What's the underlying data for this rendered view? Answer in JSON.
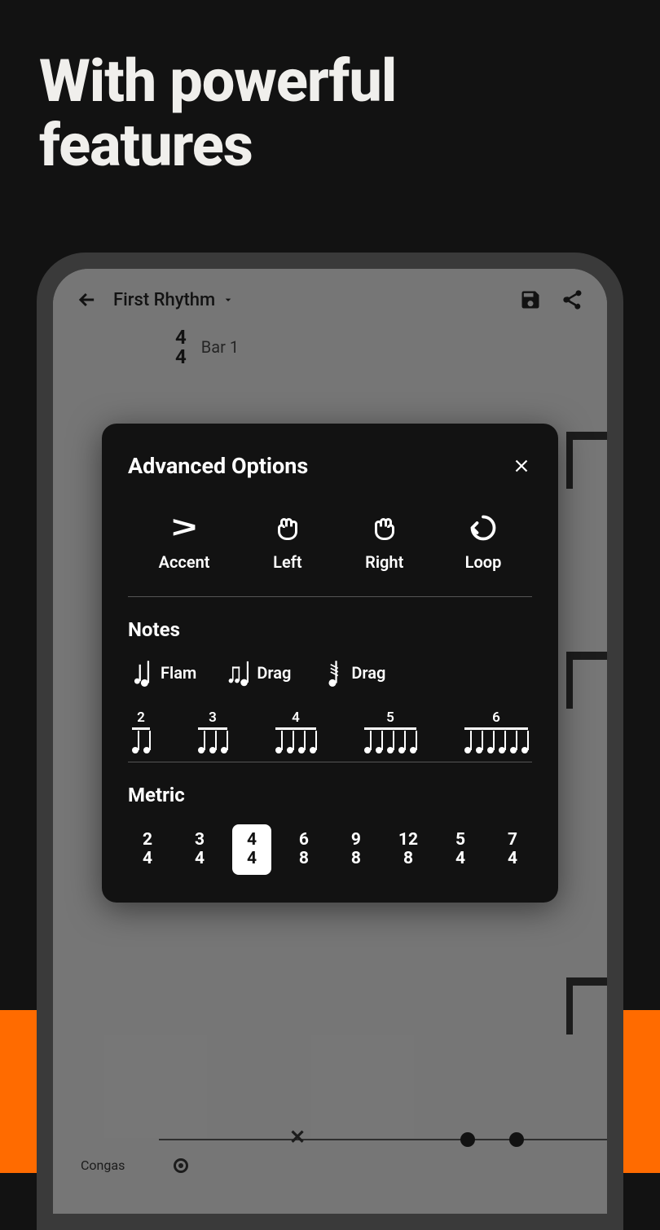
{
  "headline": "With powerful features",
  "app": {
    "title": "First Rhythm",
    "time_sig_top": "4",
    "time_sig_bottom": "4",
    "bar_label": "Bar 1",
    "instrument": "Congas"
  },
  "modal": {
    "title": "Advanced Options",
    "options": [
      {
        "label": "Accent",
        "icon": "accent"
      },
      {
        "label": "Left",
        "icon": "hand-left"
      },
      {
        "label": "Right",
        "icon": "hand-right"
      },
      {
        "label": "Loop",
        "icon": "loop"
      }
    ],
    "notes_title": "Notes",
    "notes": [
      {
        "label": "Flam",
        "icon": "flam"
      },
      {
        "label": "Drag",
        "icon": "drag"
      },
      {
        "label": "Drag",
        "icon": "drag2"
      }
    ],
    "tuplets": [
      "2",
      "3",
      "4",
      "5",
      "6"
    ],
    "metric_title": "Metric",
    "metrics": [
      {
        "top": "2",
        "bottom": "4",
        "selected": false
      },
      {
        "top": "3",
        "bottom": "4",
        "selected": false
      },
      {
        "top": "4",
        "bottom": "4",
        "selected": true
      },
      {
        "top": "6",
        "bottom": "8",
        "selected": false
      },
      {
        "top": "9",
        "bottom": "8",
        "selected": false
      },
      {
        "top": "12",
        "bottom": "8",
        "selected": false
      },
      {
        "top": "5",
        "bottom": "4",
        "selected": false
      },
      {
        "top": "7",
        "bottom": "4",
        "selected": false
      }
    ]
  }
}
